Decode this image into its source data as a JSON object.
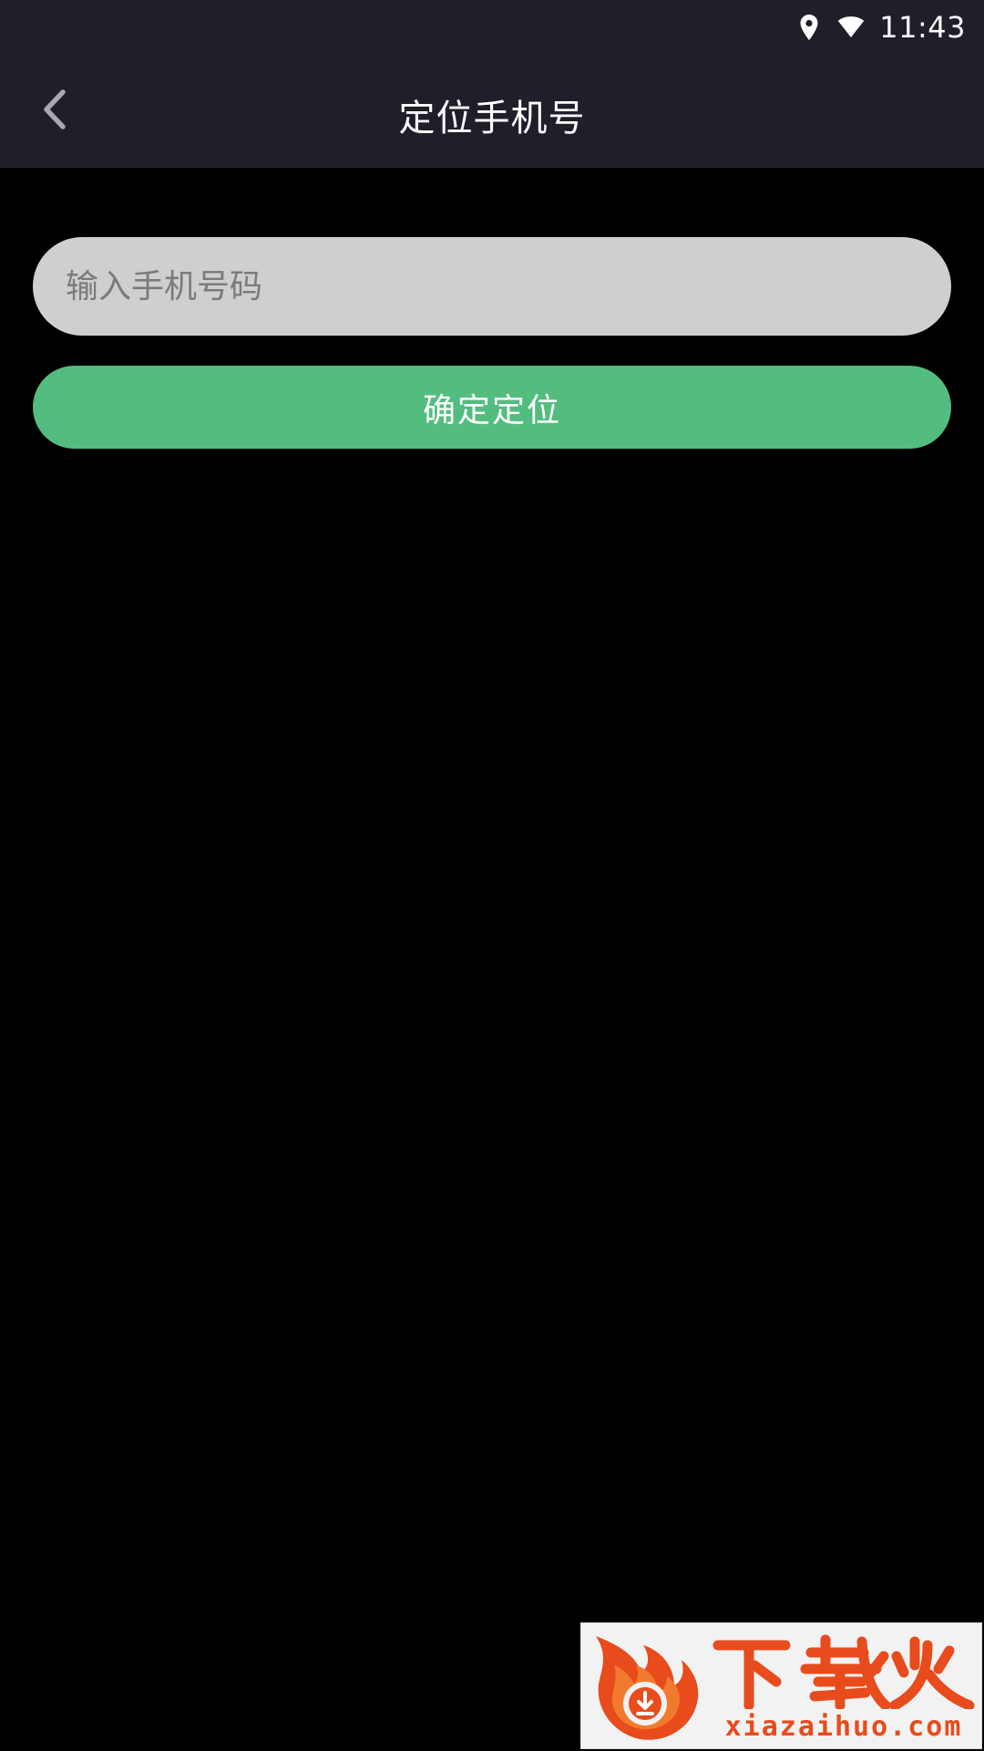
{
  "status_bar": {
    "time": "11:43",
    "icons": [
      "location-icon",
      "wifi-icon"
    ]
  },
  "header": {
    "back_icon": "chevron-left-icon",
    "title": "定位手机号"
  },
  "form": {
    "phone_input": {
      "value": "",
      "placeholder": "输入手机号码"
    },
    "submit_label": "确定定位"
  },
  "watermark": {
    "brand_text": "下载火",
    "domain": "xiazaihuo.com"
  },
  "colors": {
    "header_background": "#1e1f29",
    "page_background": "#000000",
    "input_background": "#cfcfcf",
    "button_background": "#53bd80",
    "watermark_accent": "#e84b1c"
  }
}
